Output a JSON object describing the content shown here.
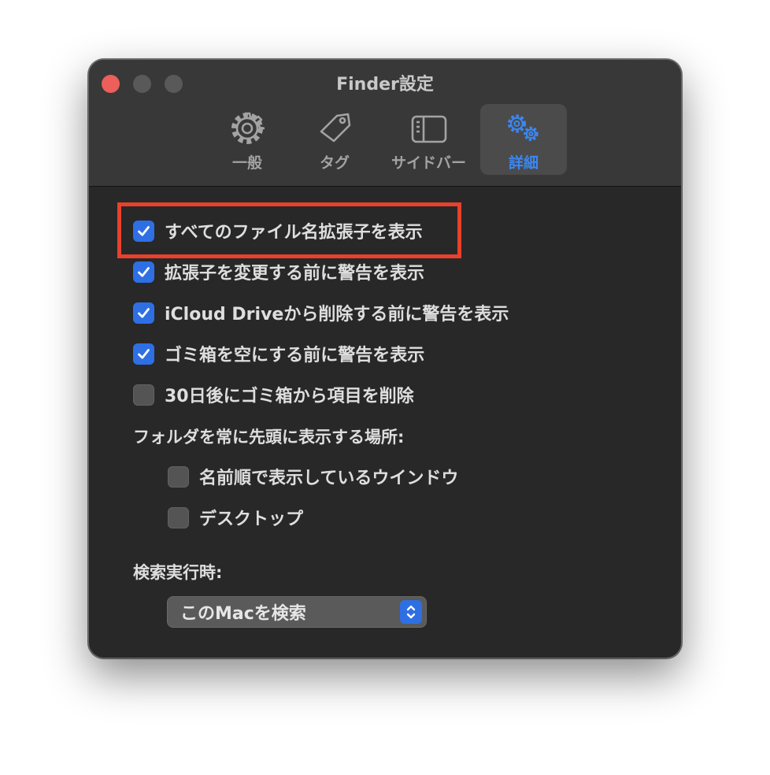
{
  "window": {
    "title": "Finder設定"
  },
  "toolbar": {
    "tabs": [
      {
        "label": "一般",
        "icon": "gear-icon"
      },
      {
        "label": "タグ",
        "icon": "tag-icon"
      },
      {
        "label": "サイドバー",
        "icon": "sidebar-icon"
      },
      {
        "label": "詳細",
        "icon": "gears-icon",
        "selected": true
      }
    ]
  },
  "options": [
    {
      "label": "すべてのファイル名拡張子を表示",
      "checked": true,
      "highlighted": true
    },
    {
      "label": "拡張子を変更する前に警告を表示",
      "checked": true
    },
    {
      "label": "iCloud Driveから削除する前に警告を表示",
      "checked": true
    },
    {
      "label": "ゴミ箱を空にする前に警告を表示",
      "checked": true
    },
    {
      "label": "30日後にゴミ箱から項目を削除",
      "checked": false
    }
  ],
  "folders_on_top": {
    "label": "フォルダを常に先頭に表示する場所:",
    "options": [
      {
        "label": "名前順で表示しているウインドウ",
        "checked": false
      },
      {
        "label": "デスクトップ",
        "checked": false
      }
    ]
  },
  "search": {
    "label": "検索実行時:",
    "selected": "このMacを検索"
  },
  "colors": {
    "accent": "#2f6fe4",
    "selected_tab_text": "#3b87f3",
    "highlight": "#e8412c",
    "close_button": "#ec5f5a"
  }
}
